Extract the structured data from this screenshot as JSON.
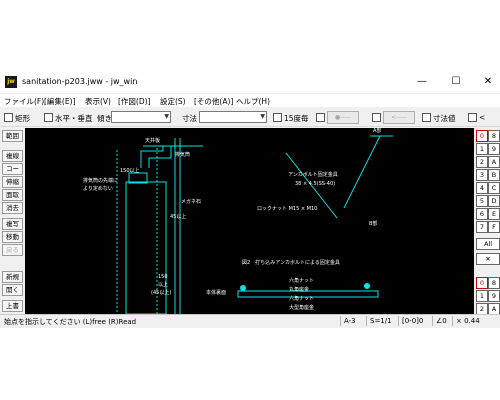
{
  "window": {
    "title": "sanitation-p203.jww - jw_win",
    "icon_label": "jw",
    "controls": {
      "minimize": "—",
      "maximize": "☐",
      "close": "✕"
    }
  },
  "menu": [
    "ファイル(F)",
    "[編集(E)]",
    "表示(V)",
    "[作図(D)]",
    "設定(S)",
    "[その他(A)]",
    "ヘルプ(H)"
  ],
  "toolbar": {
    "rect_label": "矩形",
    "hv_label": "水平・垂直",
    "slope_label": "傾き",
    "dim_label": "寸法",
    "deg15_label": "15度毎",
    "btn_a": "●-----",
    "btn_b": "<-----",
    "dimval_label": "寸法値",
    "lt_label": "<"
  },
  "left_tools": [
    "範囲",
    "複線",
    "コーナー",
    "伸縮",
    "面取",
    "消去",
    "複写",
    "移動",
    "戻る",
    "新規",
    "開く",
    "上書"
  ],
  "right_tools": {
    "rows": [
      [
        "0",
        "8"
      ],
      [
        "1",
        "9"
      ],
      [
        "2",
        "A"
      ],
      [
        "3",
        "B"
      ],
      [
        "4",
        "C"
      ],
      [
        "5",
        "D"
      ],
      [
        "6",
        "E"
      ],
      [
        "7",
        "F"
      ]
    ],
    "all": "All",
    "cross": "✕",
    "lower": [
      [
        "0",
        "8"
      ],
      [
        "1",
        "9"
      ],
      [
        "2",
        "A"
      ]
    ]
  },
  "canvas": {
    "bg": "#000000",
    "labels": {
      "ceiling": "天井板",
      "exhaust": "排気筒",
      "dim150": "150以上",
      "note1": "排気筒の先端に",
      "note2": "より定めない",
      "dim_a": "45以上",
      "dim_b": "150",
      "dim_c": "以上",
      "dim_d": "(45以上)",
      "megane": "メガネ石",
      "a_part": "A部",
      "anchor1": "アンカボルト固定金具",
      "anchor2": "38 × 4.5(SS-40)",
      "lock_nut": "ロックナット M15 × M10",
      "b_part": "B部",
      "fig2": "図2　打ち込みアンカボルトによる固定金具",
      "six_nut": "六角ナット",
      "round_washer": "丸角座金",
      "body_cover": "本体裏面",
      "six_nut2": "六角ナット",
      "big_washer": "大型角座金"
    }
  },
  "status": {
    "message": "始点を指示してください (L)free (R)Read",
    "layer": "A-3",
    "scale": "S=1/1",
    "group": "[0-0]0",
    "angle": "∠0",
    "zoom": "× 0.44"
  }
}
